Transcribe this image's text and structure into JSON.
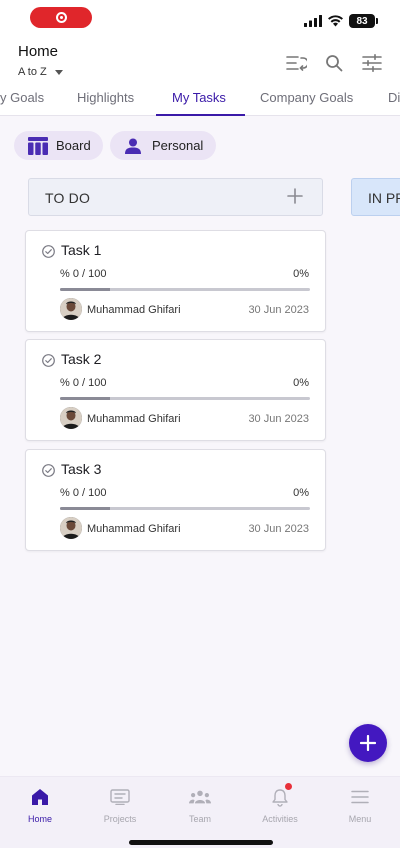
{
  "status_bar": {
    "battery": "83",
    "recording_color": "#e0262b"
  },
  "header": {
    "title": "Home",
    "sort_value": "A to Z",
    "icons": [
      "sort-icon",
      "search-icon",
      "filter-icon"
    ]
  },
  "tabs": [
    {
      "label": "y Goals"
    },
    {
      "label": "Highlights"
    },
    {
      "label": "My Tasks",
      "active": true
    },
    {
      "label": "Company Goals"
    },
    {
      "label": "Di"
    }
  ],
  "chips": {
    "board": "Board",
    "personal": "Personal"
  },
  "columns": {
    "todo": {
      "title": "TO DO"
    },
    "in_progress": {
      "title": "IN PR"
    }
  },
  "cards": [
    {
      "title": "Task 1",
      "progress_label": "% 0 / 100",
      "progress_percent": "0%",
      "progress": 0,
      "assignee": "Muhammad Ghifari",
      "date": "30 Jun 2023"
    },
    {
      "title": "Task 2",
      "progress_label": "% 0 / 100",
      "progress_percent": "0%",
      "progress": 0,
      "assignee": "Muhammad Ghifari",
      "date": "30 Jun 2023"
    },
    {
      "title": "Task 3",
      "progress_label": "% 0 / 100",
      "progress_percent": "0%",
      "progress": 0,
      "assignee": "Muhammad Ghifari",
      "date": "30 Jun 2023"
    }
  ],
  "bottom_nav": [
    {
      "label": "Home",
      "icon": "home-icon",
      "active": true
    },
    {
      "label": "Projects",
      "icon": "projects-icon"
    },
    {
      "label": "Team",
      "icon": "team-icon"
    },
    {
      "label": "Activities",
      "icon": "bell-icon",
      "notification": true
    },
    {
      "label": "Menu",
      "icon": "menu-icon"
    }
  ],
  "colors": {
    "accent": "#3a1aa8",
    "fab": "#4318c0",
    "chip_bg": "#ebe4f5",
    "todo_header_bg": "#eef0f7",
    "in_progress_header_bg": "#d8e6fa",
    "notification_dot": "#e8303a"
  }
}
